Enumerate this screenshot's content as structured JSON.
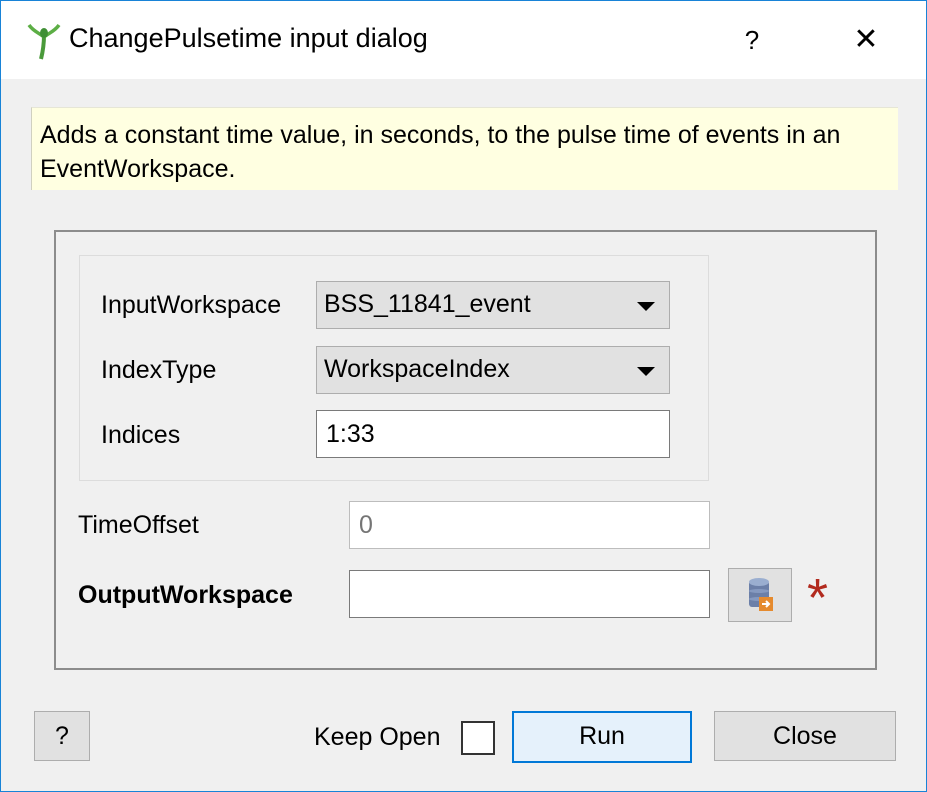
{
  "window": {
    "title": "ChangePulsetime input dialog",
    "help_glyph": "?",
    "close_glyph": "✕",
    "icon": "mantid-logo-icon"
  },
  "description": "Adds a constant time value, in seconds, to the pulse time of events in an EventWorkspace.",
  "form": {
    "input_workspace": {
      "label": "InputWorkspace",
      "value": "BSS_11841_event"
    },
    "index_type": {
      "label": "IndexType",
      "value": "WorkspaceIndex"
    },
    "indices": {
      "label": "Indices",
      "value": "1:33"
    },
    "time_offset": {
      "label": "TimeOffset",
      "placeholder": "0"
    },
    "output_workspace": {
      "label": "OutputWorkspace",
      "value": "",
      "required_marker": "*",
      "required_color": "#b22a1e",
      "browse_icon": "workspace-db-icon"
    }
  },
  "footer": {
    "help_label": "?",
    "keep_open_label": "Keep Open",
    "keep_open_checked": false,
    "run_label": "Run",
    "close_label": "Close"
  },
  "colors": {
    "accent": "#0078d7",
    "tooltip_bg": "#ffffe1"
  }
}
